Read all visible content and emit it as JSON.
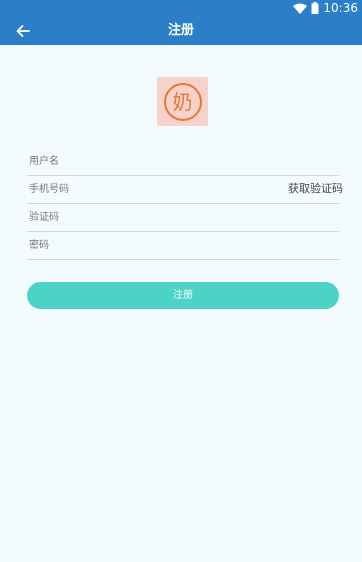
{
  "status_bar": {
    "time": "10:36",
    "wifi_icon": "wifi-icon",
    "battery_icon": "battery-icon"
  },
  "app_bar": {
    "back_icon": "arrow-left-icon",
    "title": "注册"
  },
  "logo": {
    "char": "奶"
  },
  "form": {
    "username": {
      "placeholder": "用户名",
      "value": ""
    },
    "phone": {
      "placeholder": "手机号码",
      "value": ""
    },
    "get_code_label": "获取验证码",
    "code": {
      "placeholder": "验证码",
      "value": ""
    },
    "password": {
      "placeholder": "密码",
      "value": ""
    },
    "submit_label": "注册"
  },
  "colors": {
    "primary": "#2a7fc8",
    "accent": "#4dd3c6",
    "background": "#f4fbfe"
  }
}
